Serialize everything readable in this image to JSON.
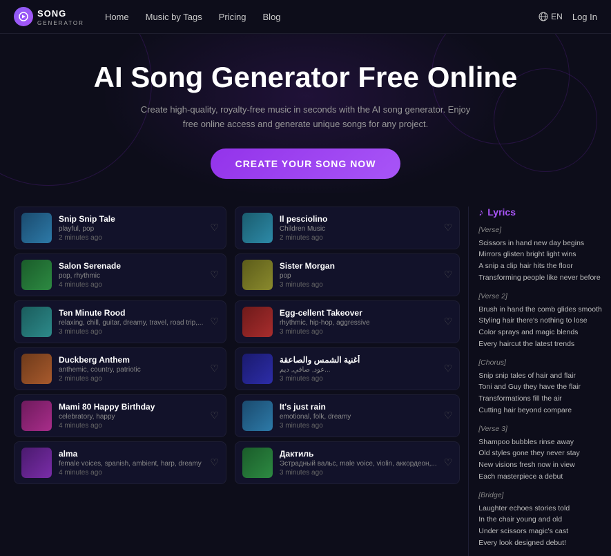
{
  "nav": {
    "logo_text": "SONG",
    "logo_sub": "GENERATOR",
    "links": [
      {
        "label": "Home",
        "id": "home"
      },
      {
        "label": "Music by Tags",
        "id": "music-by-tags"
      },
      {
        "label": "Pricing",
        "id": "pricing"
      },
      {
        "label": "Blog",
        "id": "blog"
      }
    ],
    "lang": "EN",
    "login": "Log In"
  },
  "hero": {
    "title": "AI Song Generator Free Online",
    "subtitle": "Create high-quality, royalty-free music in seconds with the AI song generator. Enjoy free online access and generate unique songs for any project.",
    "cta": "CREATE YOUR SONG NOW"
  },
  "songs_left": [
    {
      "title": "Snip Snip Tale",
      "tags": "playful, pop",
      "time": "2 minutes ago",
      "thumb": "thumb-blue"
    },
    {
      "title": "Salon Serenade",
      "tags": "pop, rhythmic",
      "time": "4 minutes ago",
      "thumb": "thumb-green"
    },
    {
      "title": "Ten Minute Rood",
      "tags": "relaxing, chill, guitar, dreamy, travel, road trip,...",
      "time": "3 minutes ago",
      "thumb": "thumb-teal"
    },
    {
      "title": "Duckberg Anthem",
      "tags": "anthemic, country, patriotic",
      "time": "2 minutes ago",
      "thumb": "thumb-orange"
    },
    {
      "title": "Mami 80 Happy Birthday",
      "tags": "celebratory, happy",
      "time": "4 minutes ago",
      "thumb": "thumb-pink"
    },
    {
      "title": "alma",
      "tags": "female voices, spanish, ambient, harp, dreamy",
      "time": "4 minutes ago",
      "thumb": "thumb-purple"
    }
  ],
  "songs_right": [
    {
      "title": "Il pesciolino",
      "tags": "Children Music",
      "time": "2 minutes ago",
      "thumb": "thumb-cyan"
    },
    {
      "title": "Sister Morgan",
      "tags": "pop",
      "time": "3 minutes ago",
      "thumb": "thumb-yellow"
    },
    {
      "title": "Egg-cellent Takeover",
      "tags": "rhythmic, hip-hop, aggressive",
      "time": "3 minutes ago",
      "thumb": "thumb-red"
    },
    {
      "title": "أغنية الشمس والصاعقة",
      "tags": "عود, صافي, ديم...",
      "time": "3 minutes ago",
      "thumb": "thumb-indigo"
    },
    {
      "title": "It's just rain",
      "tags": "emotional, folk, dreamy",
      "time": "3 minutes ago",
      "thumb": "thumb-blue"
    },
    {
      "title": "Дактиль",
      "tags": "Эстрадный вальс, male voice, violin, аккордеон,...",
      "time": "3 minutes ago",
      "thumb": "thumb-green"
    }
  ],
  "lyrics": {
    "header": "Lyrics",
    "sections": [
      {
        "label": "[Verse]",
        "lines": "Scissors in hand new day begins\nMirrors glisten bright light wins\nA snip a clip hair hits the floor\nTransforming people like never before"
      },
      {
        "label": "[Verse 2]",
        "lines": "Brush in hand the comb glides smooth\nStyling hair there's nothing to lose\nColor sprays and magic blends\nEvery haircut the latest trends"
      },
      {
        "label": "[Chorus]",
        "lines": "Snip snip tales of hair and flair\nToni and Guy they have the flair\nTransformations fill the air\nCutting hair beyond compare"
      },
      {
        "label": "[Verse 3]",
        "lines": "Shampoo bubbles rinse away\nOld styles gone they never stay\nNew visions fresh now in view\nEach masterpiece a debut"
      },
      {
        "label": "[Bridge]",
        "lines": "Laughter echoes stories told\nIn the chair young and old\nUnder scissors magic's cast\nEvery look designed debut!"
      }
    ]
  }
}
